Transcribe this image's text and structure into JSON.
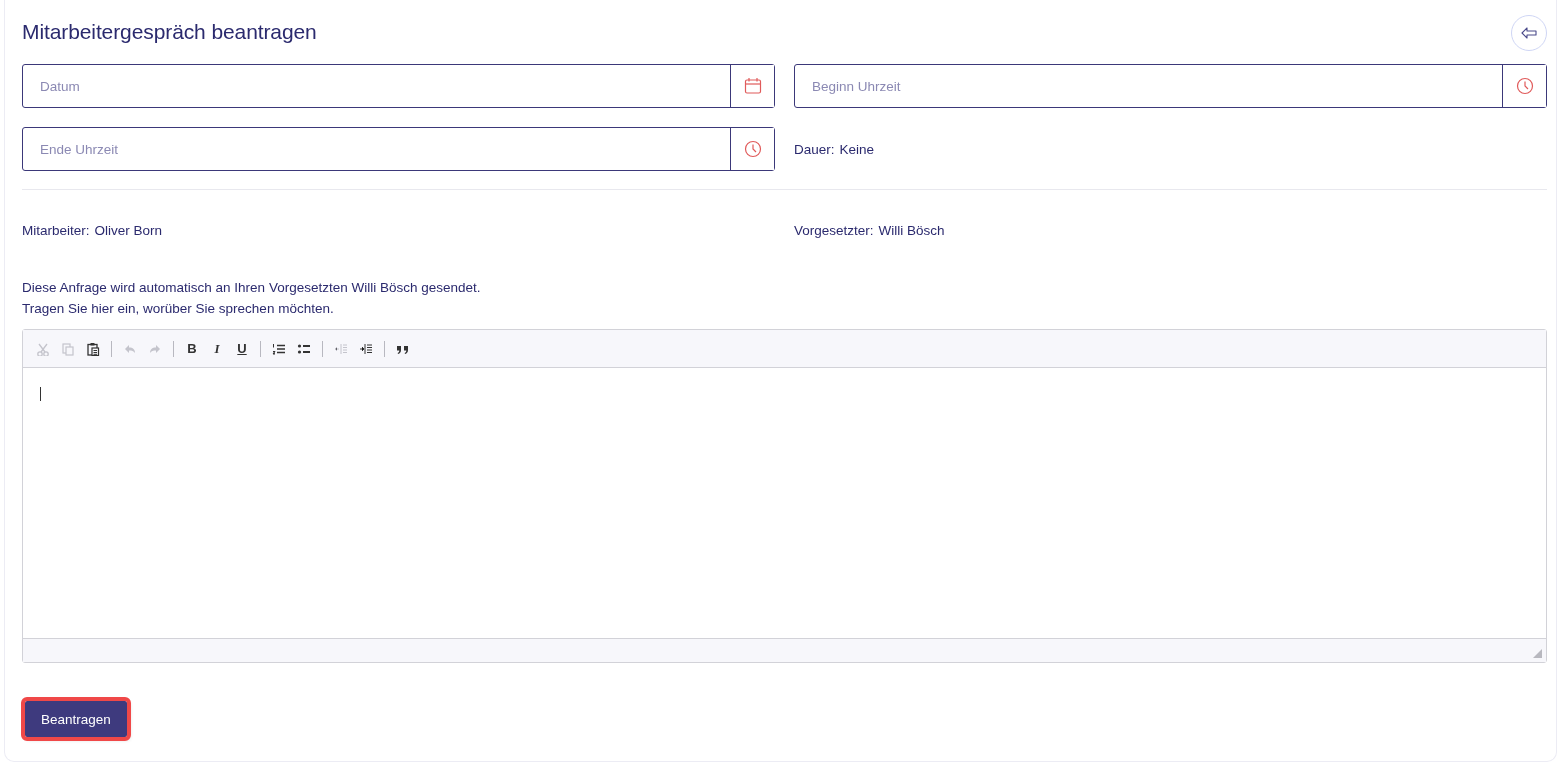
{
  "title": "Mitarbeitergespräch beantragen",
  "fields": [
    {
      "placeholder": "Datum",
      "kind": "date"
    },
    {
      "placeholder": "Beginn Uhrzeit",
      "kind": "time"
    },
    {
      "placeholder": "Ende Uhrzeit",
      "kind": "time"
    }
  ],
  "duration": {
    "label": "Dauer:",
    "value": "Keine"
  },
  "people": [
    {
      "label": "Mitarbeiter:",
      "value": "Oliver Born"
    },
    {
      "label": "Vorgesetzter:",
      "value": "Willi Bösch"
    }
  ],
  "info_lines": [
    "Diese Anfrage wird automatisch an Ihren Vorgesetzten Willi Bösch gesendet.",
    "Tragen Sie hier ein, worüber Sie sprechen möchten."
  ],
  "toolbar": [
    [
      {
        "kind": "cut",
        "disabled": true
      },
      {
        "kind": "copy",
        "disabled": true
      },
      {
        "kind": "paste",
        "disabled": false
      }
    ],
    [
      {
        "kind": "undo",
        "disabled": true
      },
      {
        "kind": "redo",
        "disabled": true
      }
    ],
    [
      {
        "kind": "bold",
        "label": "B",
        "disabled": false
      },
      {
        "kind": "italic",
        "label": "I",
        "disabled": false
      },
      {
        "kind": "underline",
        "label": "U",
        "disabled": false
      }
    ],
    [
      {
        "kind": "numbered-list",
        "disabled": false
      },
      {
        "kind": "bullet-list",
        "disabled": false
      }
    ],
    [
      {
        "kind": "outdent",
        "disabled": true
      },
      {
        "kind": "indent",
        "disabled": false
      }
    ],
    [
      {
        "kind": "quote",
        "disabled": false
      }
    ]
  ],
  "submit": {
    "label": "Beantragen",
    "highlighted": true
  }
}
